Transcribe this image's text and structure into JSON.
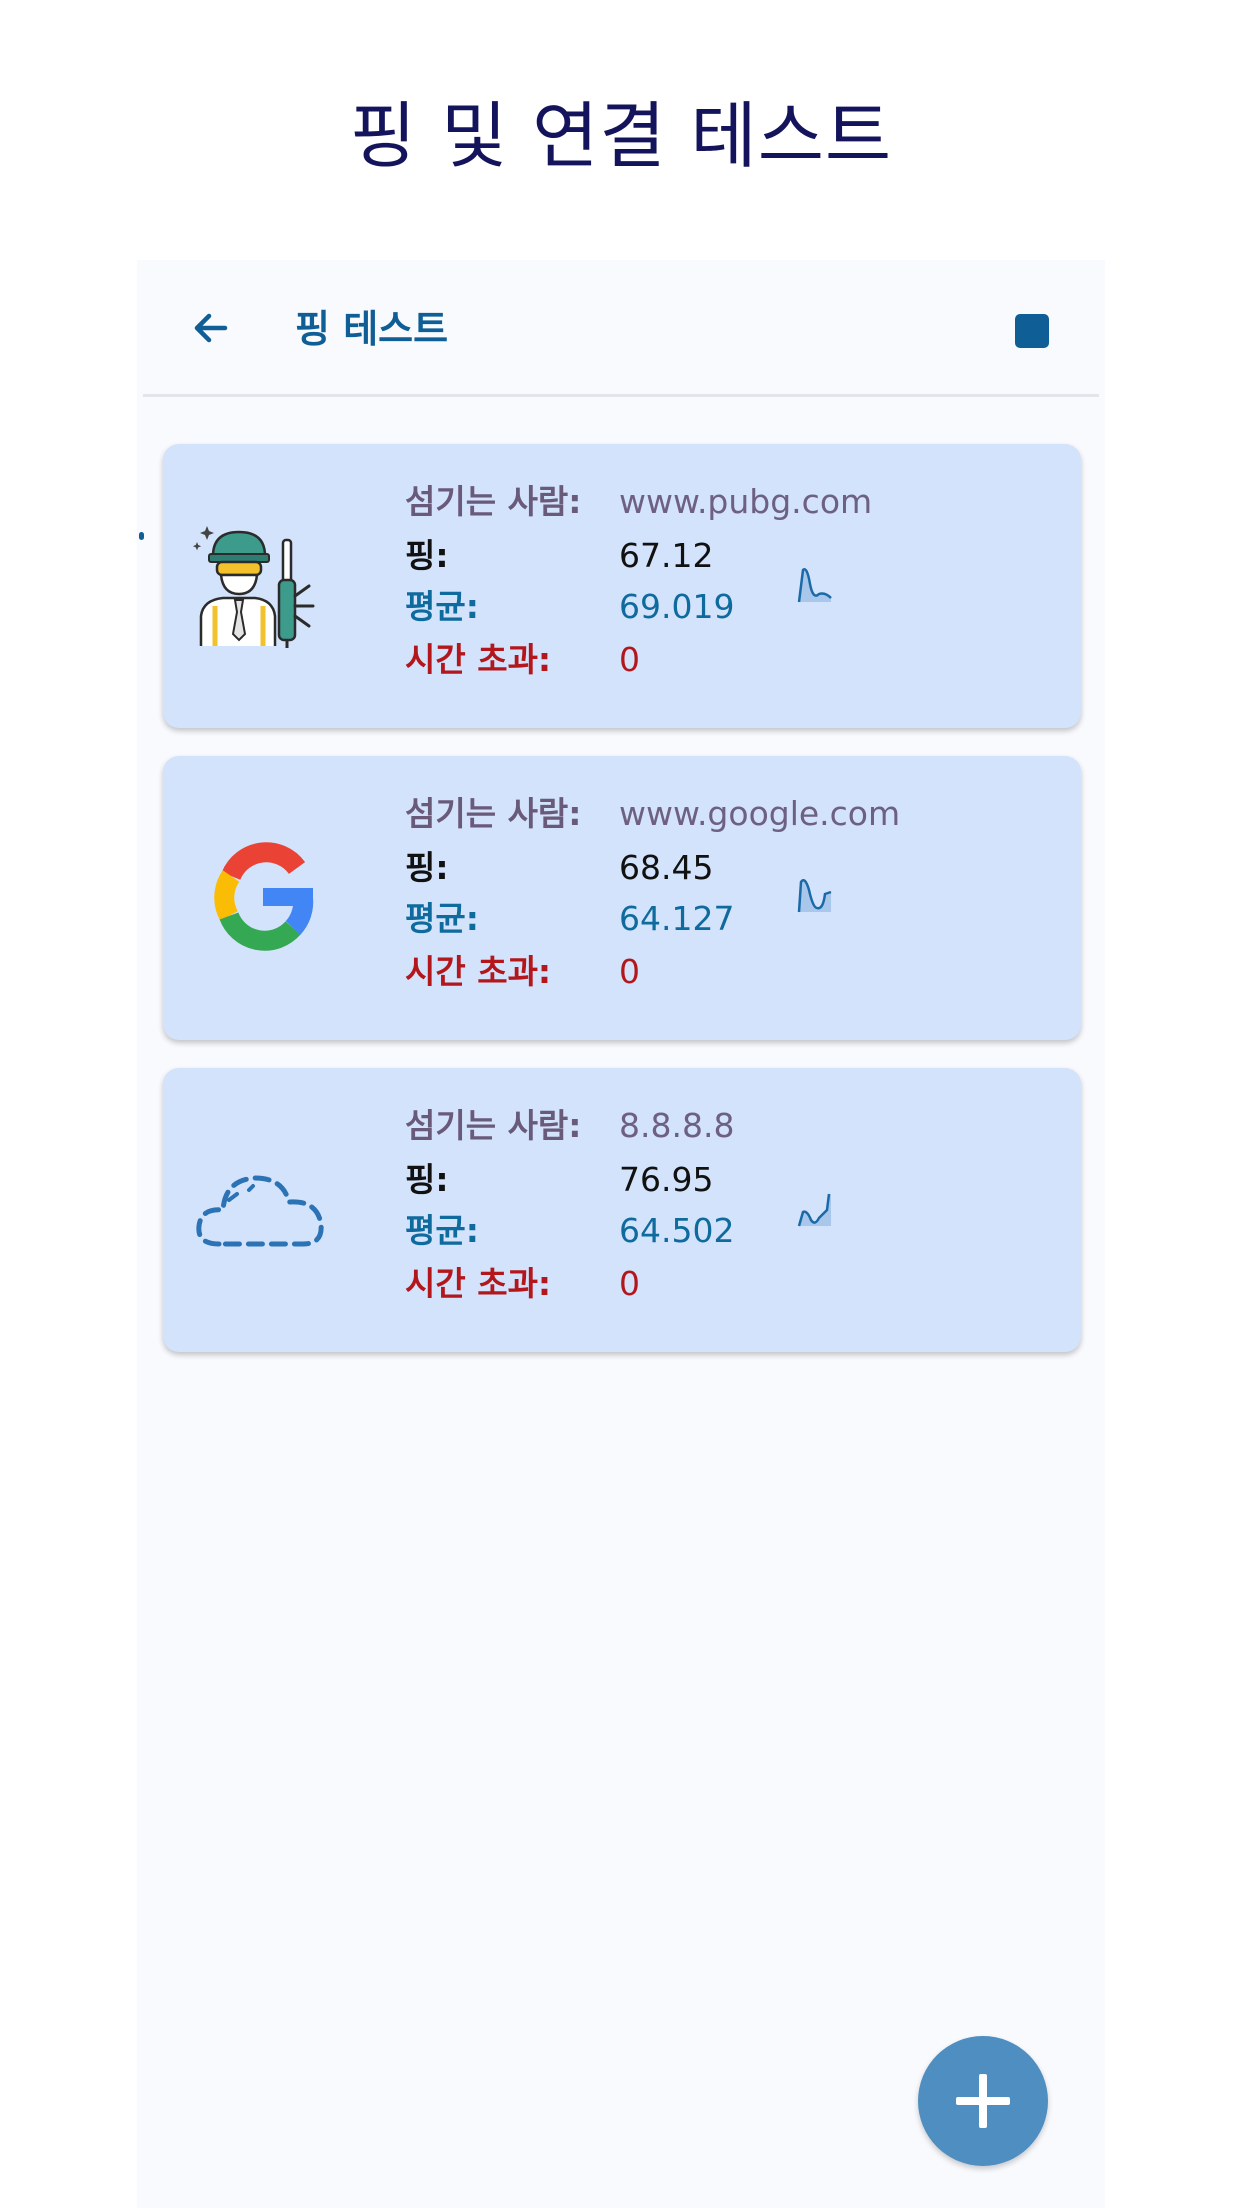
{
  "page_title": "핑 및 연결 테스트",
  "appbar": {
    "title": "핑 테스트",
    "back_icon": "arrow-left-icon",
    "stop_icon": "stop-icon"
  },
  "labels": {
    "server": "섬기는 사람:",
    "ping": "핑:",
    "average": "평균:",
    "timeout": "시간 초과:"
  },
  "cards": [
    {
      "icon": "soldier-icon",
      "server": "www.pubg.com",
      "ping": "67.12",
      "average": "69.019",
      "timeout": "0"
    },
    {
      "icon": "google-logo-icon",
      "server": "www.google.com",
      "ping": "68.45",
      "average": "64.127",
      "timeout": "0"
    },
    {
      "icon": "cloud-icon",
      "server": "8.8.8.8",
      "ping": "76.95",
      "average": "64.502",
      "timeout": "0"
    }
  ],
  "fab": {
    "icon": "plus-icon"
  },
  "colors": {
    "title": "#14145c",
    "accent": "#0f5e96",
    "card_bg": "#d2e3fb",
    "average": "#0f6a9e",
    "timeout": "#b3171c",
    "fab": "#4f8ec0"
  }
}
